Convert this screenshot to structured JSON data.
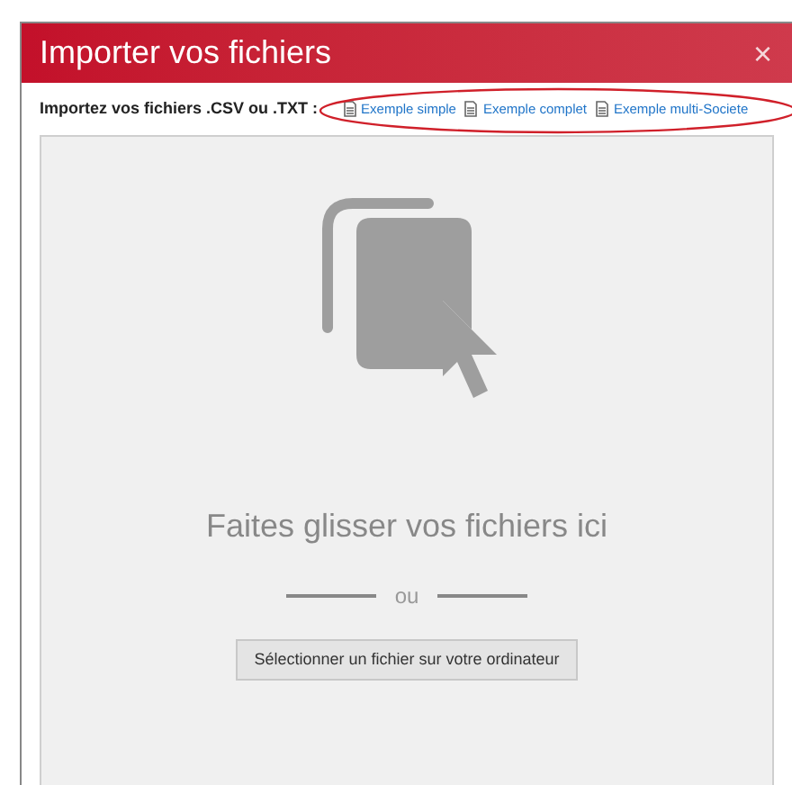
{
  "window": {
    "title": "Importer vos fichiers",
    "close": "×"
  },
  "intro": "Importez vos fichiers .CSV ou .TXT :",
  "example_links": [
    {
      "label": "Exemple simple"
    },
    {
      "label": "Exemple complet"
    },
    {
      "label": "Exemple multi-Societe"
    }
  ],
  "dropzone": {
    "message": "Faites glisser vos fichiers ici",
    "separator": "ou",
    "button": "Sélectionner un fichier sur votre ordinateur"
  }
}
